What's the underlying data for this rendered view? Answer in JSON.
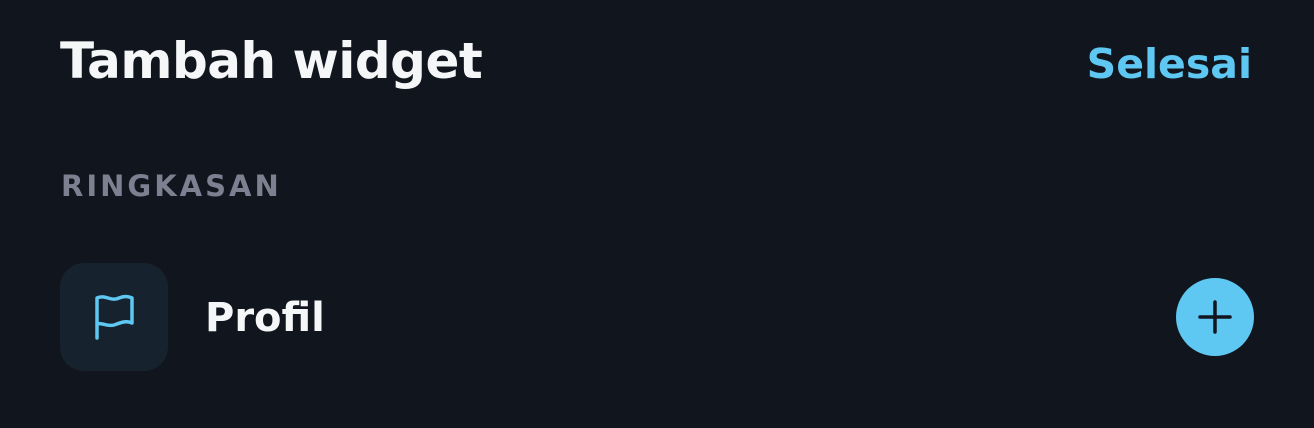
{
  "header": {
    "title": "Tambah widget",
    "done_label": "Selesai"
  },
  "section": {
    "title": "RINGKASAN",
    "items": [
      {
        "label": "Profil",
        "icon": "flag-icon",
        "action_icon": "plus-icon"
      }
    ]
  },
  "colors": {
    "background": "#11151e",
    "accent": "#5fc8f2",
    "tile_background": "#16222e",
    "section_header": "#7b8190",
    "text": "#f5f6f8"
  }
}
